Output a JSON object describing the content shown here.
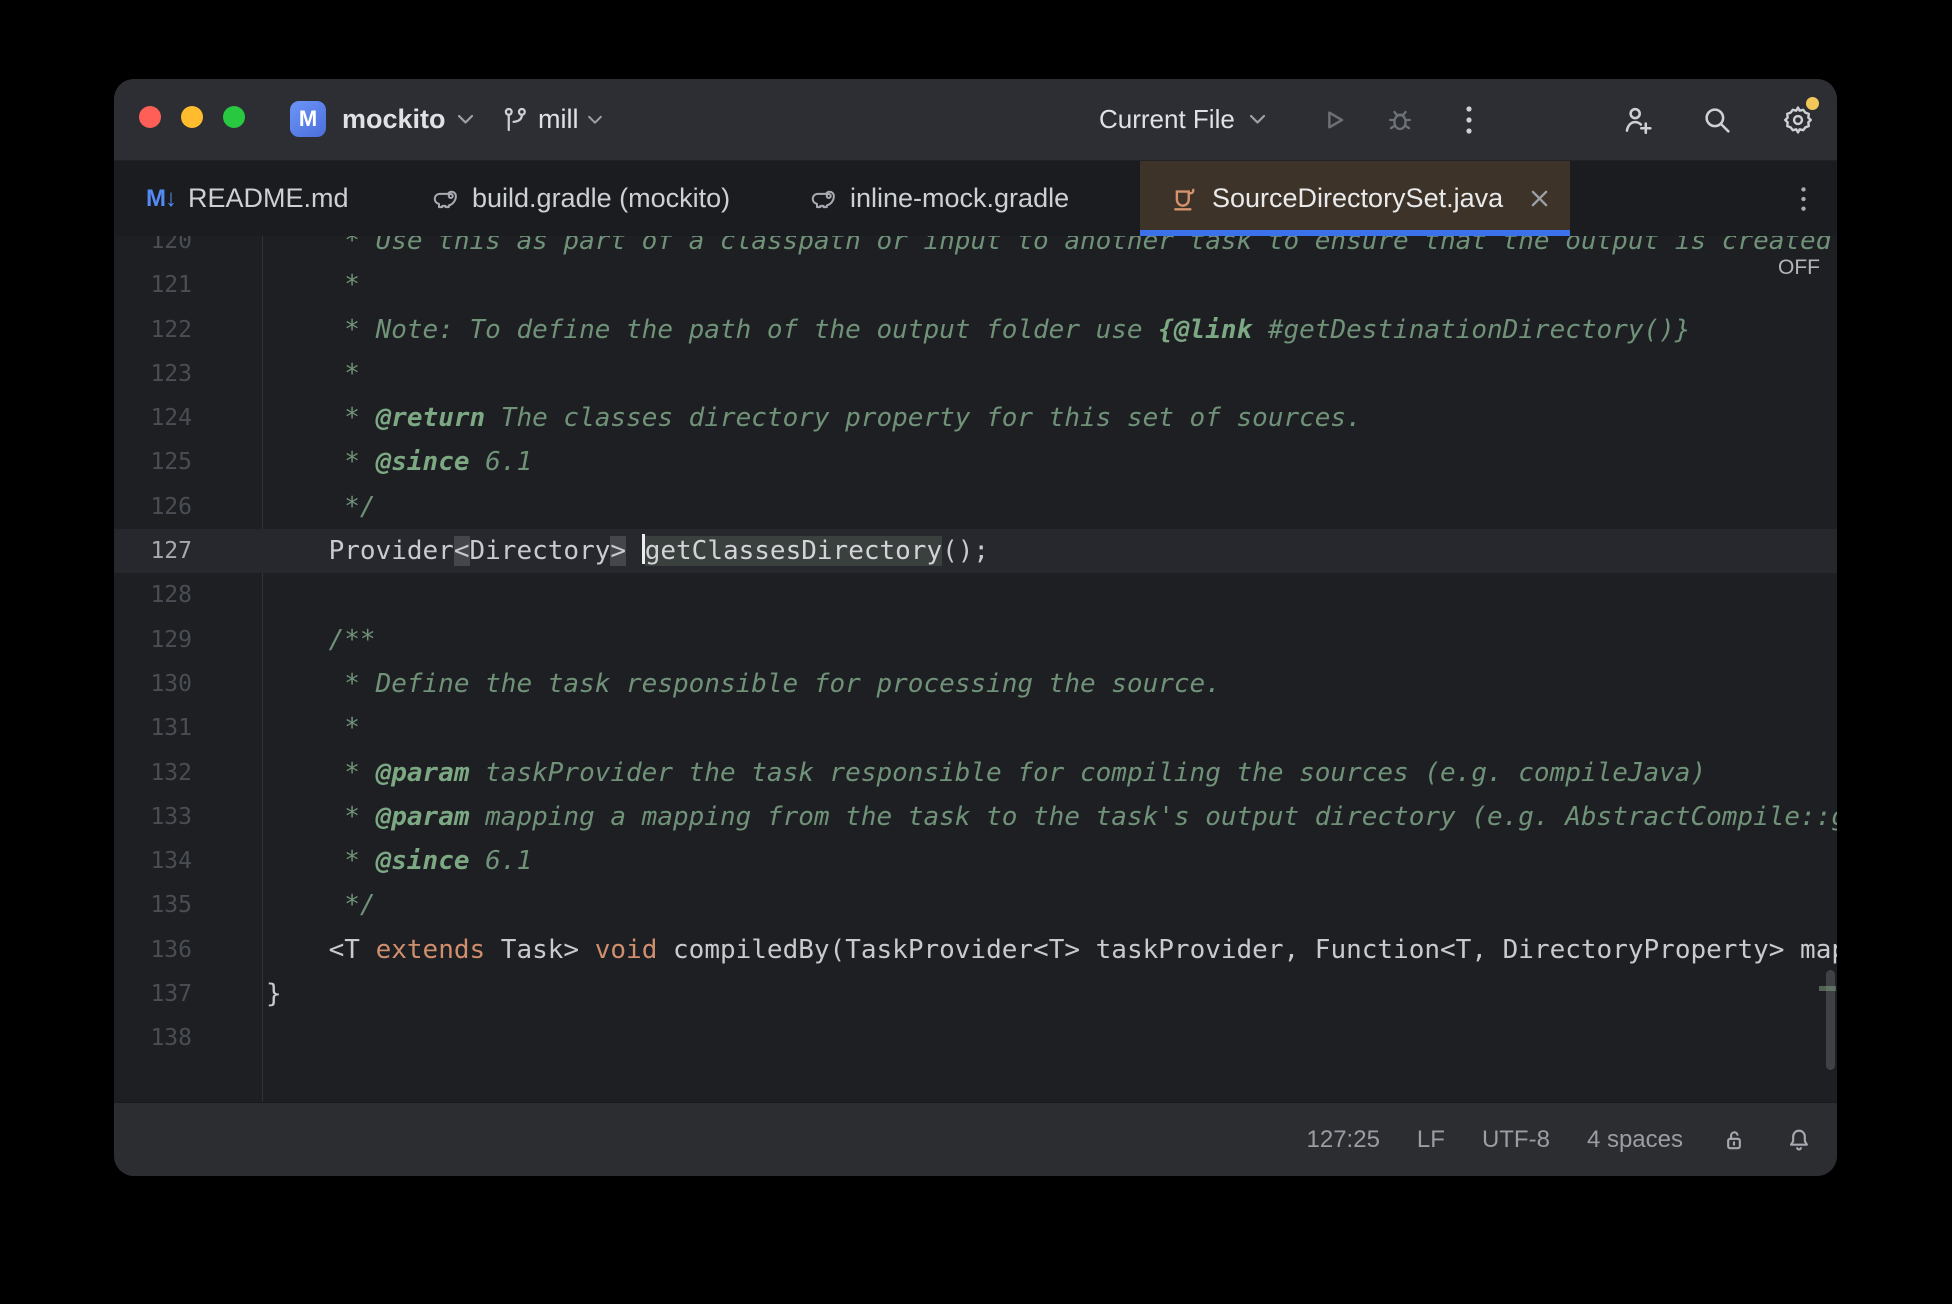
{
  "window": {
    "project_initial": "M",
    "project_name": "mockito",
    "branch_name": "mill",
    "run_config": "Current File"
  },
  "tabs": [
    {
      "label": "README.md",
      "icon": "markdown",
      "active": false
    },
    {
      "label": "build.gradle (mockito)",
      "icon": "gradle",
      "active": false
    },
    {
      "label": "inline-mock.gradle",
      "icon": "gradle",
      "active": false
    },
    {
      "label": "SourceDirectorySet.java",
      "icon": "java-class",
      "active": true
    }
  ],
  "editor": {
    "hint_off": "OFF",
    "lines": [
      {
        "n": "120",
        "s": [
          {
            "c": "d",
            "t": "     * Use this as part of a classpath or input to another task to ensure that the output is created"
          }
        ]
      },
      {
        "n": "121",
        "s": [
          {
            "c": "d",
            "t": "     *"
          }
        ]
      },
      {
        "n": "122",
        "s": [
          {
            "c": "d",
            "t": "     * Note: To define the path of the output folder use "
          },
          {
            "c": "t",
            "t": "{@link"
          },
          {
            "c": "d",
            "t": " #getDestinationDirectory()}"
          }
        ]
      },
      {
        "n": "123",
        "s": [
          {
            "c": "d",
            "t": "     *"
          }
        ]
      },
      {
        "n": "124",
        "s": [
          {
            "c": "d",
            "t": "     * "
          },
          {
            "c": "t",
            "t": "@return"
          },
          {
            "c": "d",
            "t": " The classes directory property for this set of sources."
          }
        ]
      },
      {
        "n": "125",
        "s": [
          {
            "c": "d",
            "t": "     * "
          },
          {
            "c": "t",
            "t": "@since"
          },
          {
            "c": "d",
            "t": " 6.1"
          }
        ]
      },
      {
        "n": "126",
        "s": [
          {
            "c": "d",
            "t": "     */"
          }
        ]
      },
      {
        "n": "127",
        "cur": true,
        "s": [
          {
            "c": "p",
            "t": "    Provider"
          },
          {
            "c": "b",
            "t": "<"
          },
          {
            "c": "p",
            "t": "Directory"
          },
          {
            "c": "b",
            "t": ">"
          },
          {
            "c": "p",
            "t": " "
          },
          {
            "caret": true
          },
          {
            "c": "i",
            "t": "getClassesDirectory"
          },
          {
            "c": "p",
            "t": "();"
          }
        ]
      },
      {
        "n": "128",
        "s": []
      },
      {
        "n": "129",
        "s": [
          {
            "c": "d",
            "t": "    /**"
          }
        ]
      },
      {
        "n": "130",
        "s": [
          {
            "c": "d",
            "t": "     * Define the task responsible for processing the source."
          }
        ]
      },
      {
        "n": "131",
        "s": [
          {
            "c": "d",
            "t": "     *"
          }
        ]
      },
      {
        "n": "132",
        "s": [
          {
            "c": "d",
            "t": "     * "
          },
          {
            "c": "t",
            "t": "@param"
          },
          {
            "c": "d",
            "t": " taskProvider the task responsible for compiling the sources (e.g. compileJava)"
          }
        ]
      },
      {
        "n": "133",
        "s": [
          {
            "c": "d",
            "t": "     * "
          },
          {
            "c": "t",
            "t": "@param"
          },
          {
            "c": "d",
            "t": " mapping a mapping from the task to the task's output directory (e.g. AbstractCompile::getDestinationDirectory)"
          }
        ]
      },
      {
        "n": "134",
        "s": [
          {
            "c": "d",
            "t": "     * "
          },
          {
            "c": "t",
            "t": "@since"
          },
          {
            "c": "d",
            "t": " 6.1"
          }
        ]
      },
      {
        "n": "135",
        "s": [
          {
            "c": "d",
            "t": "     */"
          }
        ]
      },
      {
        "n": "136",
        "s": [
          {
            "c": "p",
            "t": "    <T "
          },
          {
            "c": "k",
            "t": "extends"
          },
          {
            "c": "p",
            "t": " Task> "
          },
          {
            "c": "k",
            "t": "void"
          },
          {
            "c": "p",
            "t": " compiledBy(TaskProvider<T> taskProvider, Function<T, DirectoryProperty> mapping);"
          }
        ]
      },
      {
        "n": "137",
        "s": [
          {
            "c": "p",
            "t": "}"
          }
        ]
      },
      {
        "n": "138",
        "s": []
      }
    ]
  },
  "status_bar": {
    "caret_position": "127:25",
    "line_ending": "LF",
    "encoding": "UTF-8",
    "indent": "4 spaces"
  },
  "colors": {
    "editor_bg": "#1e1f22",
    "titlebar_bg": "#2c2e33",
    "tabbar_bg": "#1a1c1f",
    "active_tab_bg": "#3e3329",
    "tab_underline_blue": "#3b72ec",
    "keyword_orange": "#cf8e6d",
    "doc_comment_green": "#6f9279",
    "plain_code": "#c8cad0",
    "java_icon_orange": "#d4936c",
    "markdown_icon_blue": "#548af7",
    "gear_badge_yellow": "#f2c75a",
    "traffic_red": "#ff5f57",
    "traffic_yellow": "#febc2e",
    "traffic_green": "#28c840"
  }
}
